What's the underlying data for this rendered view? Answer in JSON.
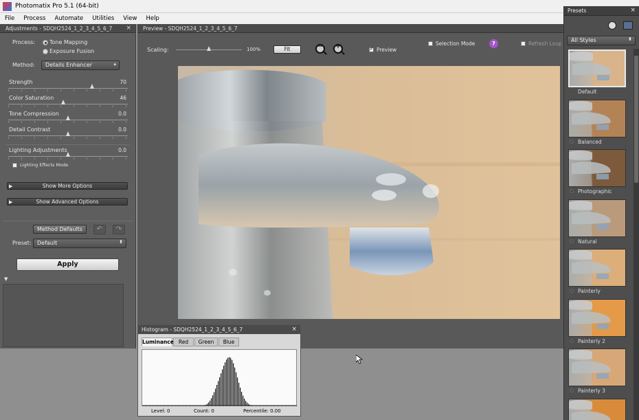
{
  "window": {
    "title": "Photomatix Pro 5.1 (64-bit)",
    "min": "–",
    "max": "☐",
    "close": "✕"
  },
  "menu": [
    "File",
    "Process",
    "Automate",
    "Utilities",
    "View",
    "Help"
  ],
  "adjustments": {
    "title": "Adjustments - SDQH2524_1_2_3_4_5_6_7",
    "close": "×",
    "process_label": "Process:",
    "process_options": [
      "Tone Mapping",
      "Exposure Fusion"
    ],
    "process_selected": 0,
    "method_label": "Method:",
    "method_value": "Details Enhancer",
    "sliders": [
      {
        "label": "Strength",
        "value": "70",
        "min": 0,
        "max": 100,
        "level": 70
      },
      {
        "label": "Color Saturation",
        "value": "46",
        "min": 0,
        "max": 100,
        "level": 46
      },
      {
        "label": "Tone Compression",
        "value": "0.0",
        "min": -10,
        "max": 10,
        "level": 0
      },
      {
        "label": "Detail Contrast",
        "value": "0.0",
        "min": -10,
        "max": 10,
        "level": 0
      }
    ],
    "lighting": {
      "label": "Lighting Adjustments",
      "value": "0.0",
      "min": -10,
      "max": 10,
      "level": 0
    },
    "lighting_mode_label": "Lighting Effects Mode",
    "lighting_mode_checked": false,
    "show_more": "Show More Options",
    "show_advanced": "Show Advanced Options",
    "method_defaults": "Method Defaults",
    "undo_glyph": "↶",
    "redo_glyph": "↷",
    "preset_label": "Preset:",
    "preset_value": "Default",
    "apply": "Apply",
    "loupe_toggle": "▼"
  },
  "preview": {
    "title": "Preview - SDQH2524_1_2_3_4_5_6_7",
    "scaling_label": "Scaling:",
    "scaling_value": "100%",
    "scaling_level": 0.5,
    "fit_button": "Fit",
    "zoom_out_glyph": "−",
    "zoom_in_glyph": "+",
    "preview_label": "Preview",
    "preview_checked": true,
    "selection_mode_label": "Selection Mode",
    "selection_mode_checked": false,
    "help_glyph": "?",
    "refresh_label": "Refresh Loupe",
    "refresh_checked": false
  },
  "histogram": {
    "title": "Histogram - SDQH2524_1_2_3_4_5_6_7",
    "close": "×",
    "tabs": [
      "Luminance",
      "Red",
      "Green",
      "Blue"
    ],
    "active_tab": 0,
    "level": "Level: 0",
    "count": "Count: 0",
    "percentile": "Percentile: 0.00"
  },
  "presets": {
    "title": "Presets",
    "close": "×",
    "filter": "All Styles",
    "items": [
      {
        "label": "Default",
        "tone": "#d9b48b"
      },
      {
        "label": "Balanced",
        "tone": "#b38356"
      },
      {
        "label": "Photographic",
        "tone": "#7d5a3c"
      },
      {
        "label": "Natural",
        "tone": "#b99a7a"
      },
      {
        "label": "Painterly",
        "tone": "#dcae7a"
      },
      {
        "label": "Painterly 2",
        "tone": "#e49a48"
      },
      {
        "label": "Painterly 3",
        "tone": "#d8a778"
      },
      {
        "label": "",
        "tone": "#d98b3c"
      }
    ],
    "selected": 0
  },
  "colors": {
    "panel": "#5e5e5e",
    "preview_bg": "#595959",
    "accent": "#e6c9a2"
  }
}
